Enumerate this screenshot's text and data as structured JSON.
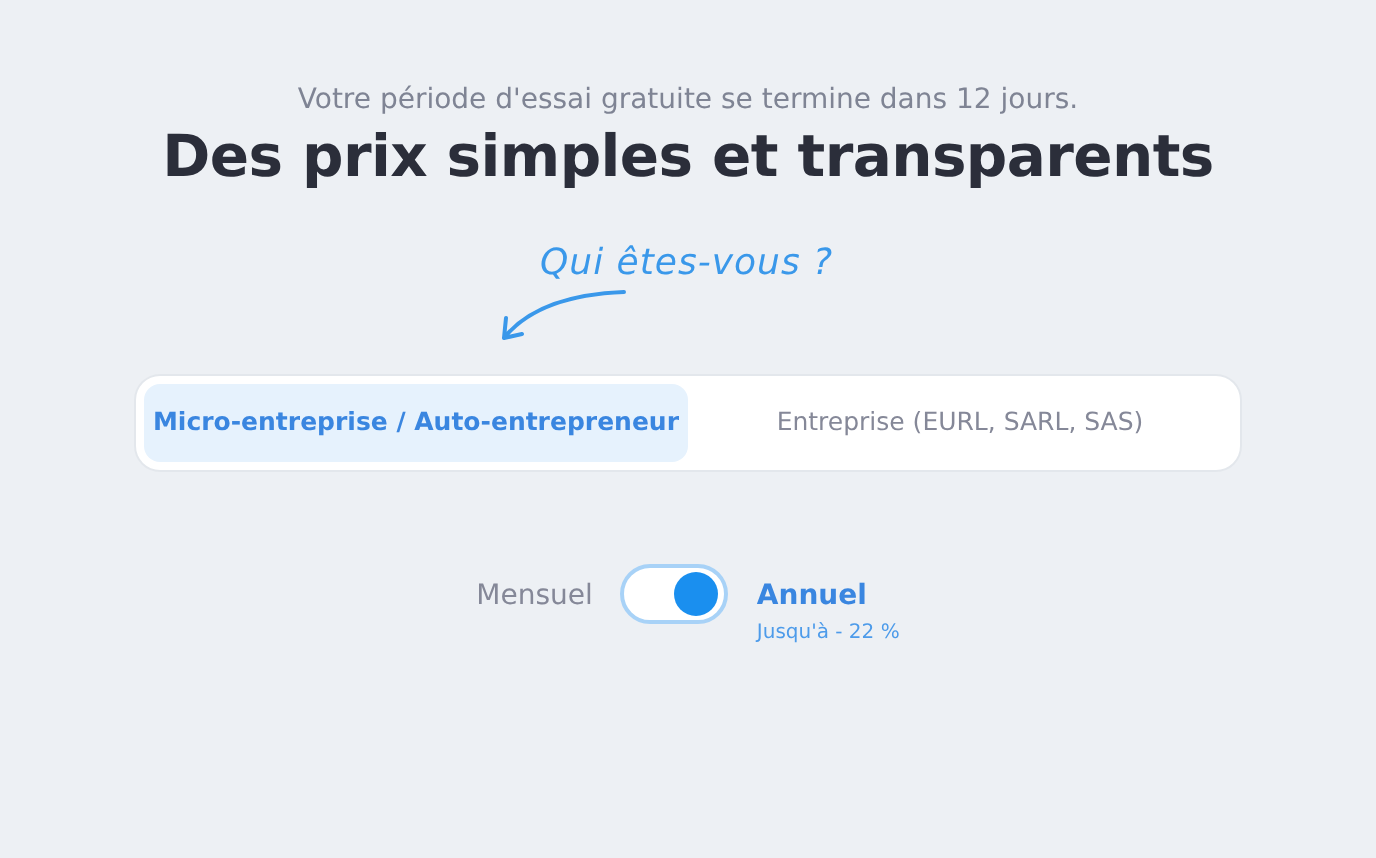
{
  "trial_notice": "Votre période d'essai gratuite se termine dans 12 jours.",
  "title": "Des prix simples et transparents",
  "hint": "Qui êtes-vous ?",
  "segments": [
    {
      "label": "Micro-entreprise / Auto-entrepreneur",
      "selected": true
    },
    {
      "label": "Entreprise (EURL, SARL, SAS)",
      "selected": false
    }
  ],
  "billing": {
    "monthly": {
      "label": "Mensuel",
      "selected": false
    },
    "annual": {
      "label": "Annuel",
      "selected": true,
      "note": "Jusqu'à - 22 %"
    },
    "on": true
  }
}
